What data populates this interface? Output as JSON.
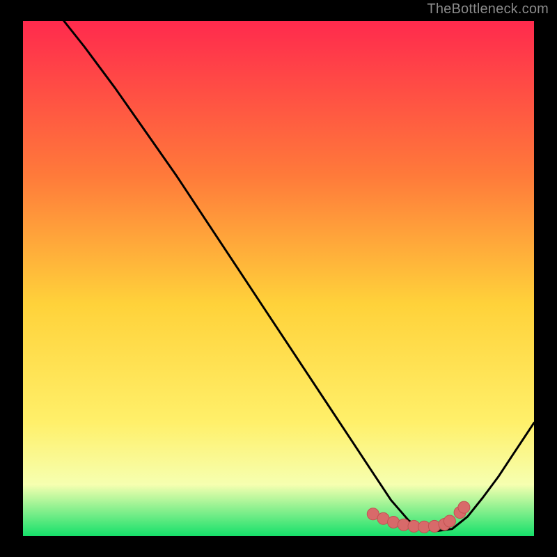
{
  "watermark": "TheBottleneck.com",
  "colors": {
    "bg": "#000000",
    "grad_top": "#ff2a4d",
    "grad_mid1": "#ff7a3a",
    "grad_mid2": "#ffd23a",
    "grad_mid3": "#fff06a",
    "grad_mid4": "#f6ffb0",
    "grad_bottom": "#15e06a",
    "curve": "#000000",
    "marker_fill": "#d86a6a",
    "marker_stroke": "#c15252"
  },
  "chart_data": {
    "type": "line",
    "title": "",
    "xlabel": "",
    "ylabel": "",
    "xlim": [
      0,
      100
    ],
    "ylim": [
      0,
      100
    ],
    "series": [
      {
        "name": "bottleneck-curve",
        "x": [
          8,
          12,
          18,
          24,
          30,
          36,
          42,
          48,
          54,
          60,
          64,
          68,
          72,
          75.5,
          78,
          81,
          84,
          87,
          90,
          93,
          96,
          100
        ],
        "y": [
          100,
          95,
          87,
          78.5,
          70,
          61,
          52,
          43,
          34,
          25,
          19,
          13,
          7,
          3,
          1.5,
          1,
          1.4,
          3.8,
          7.5,
          11.5,
          16,
          22
        ]
      }
    ],
    "markers": {
      "name": "highlight-dots",
      "x": [
        68.5,
        70.5,
        72.5,
        74.5,
        76.5,
        78.5,
        80.5,
        82.5,
        83.5,
        85.5,
        86.3
      ],
      "y": [
        4.3,
        3.4,
        2.7,
        2.2,
        1.9,
        1.8,
        1.9,
        2.3,
        2.9,
        4.6,
        5.6
      ]
    }
  }
}
